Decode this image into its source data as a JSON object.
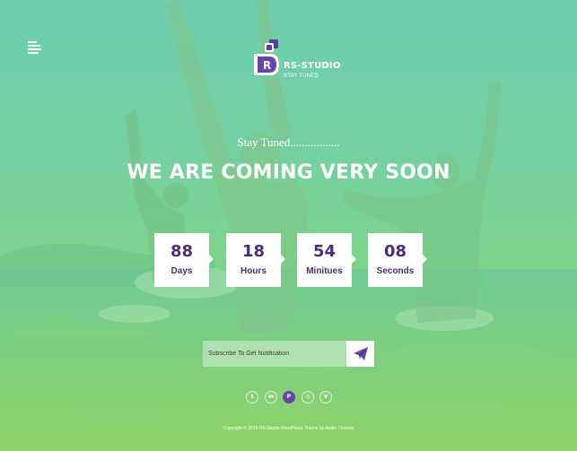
{
  "brand": {
    "logo_letter": "R",
    "name": "RS-STUDIO",
    "tagline": "STAY TUNED"
  },
  "hero": {
    "stay_tuned": "Stay Tuned.................",
    "headline": "WE ARE COMING VERY SOON"
  },
  "countdown": [
    {
      "value": "88",
      "label": "Days"
    },
    {
      "value": "18",
      "label": "Hours"
    },
    {
      "value": "54",
      "label": "Minitues"
    },
    {
      "value": "08",
      "label": "Seconds"
    }
  ],
  "subscribe": {
    "placeholder": "Subscribe To Get Notification",
    "value": ""
  },
  "social": [
    {
      "icon": "twitter-icon",
      "glyph": "t",
      "active": false
    },
    {
      "icon": "linkedin-icon",
      "glyph": "in",
      "active": false
    },
    {
      "icon": "pinterest-icon",
      "glyph": "P",
      "active": true
    },
    {
      "icon": "instagram-icon",
      "glyph": "◎",
      "active": false
    },
    {
      "icon": "vimeo-icon",
      "glyph": "V",
      "active": false
    }
  ],
  "footer": {
    "copyright": "Copyright © 2018 RS-Studio WordPress Theme by Andin Themes"
  },
  "colors": {
    "accent": "#6a45a8",
    "countdown_text": "#4b2d78",
    "overlay_top": "#6fcdb0",
    "overlay_bottom": "#93d96e"
  }
}
